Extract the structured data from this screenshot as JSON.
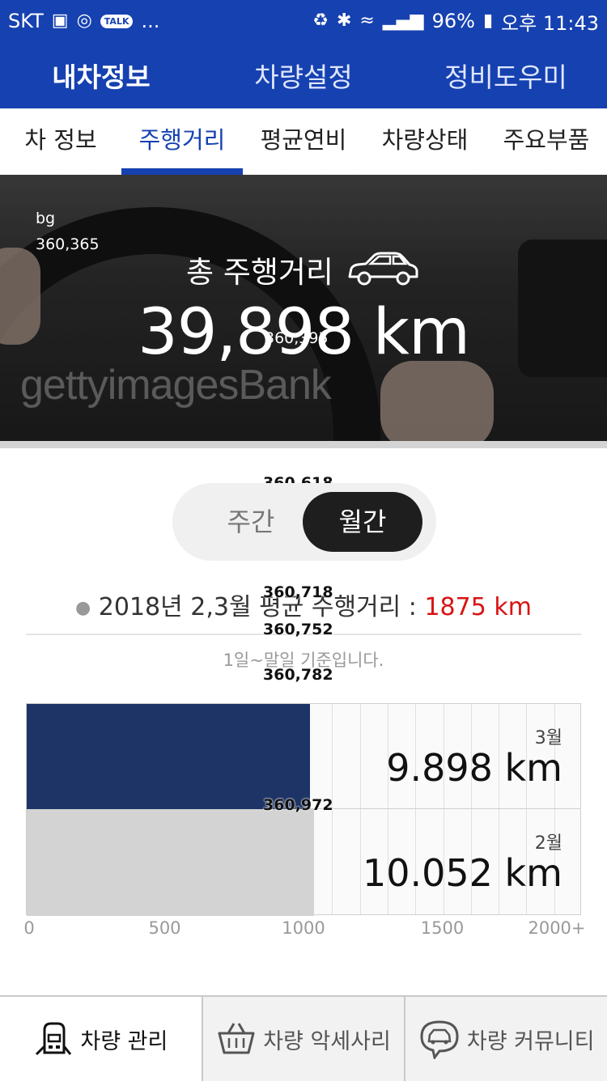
{
  "status_bar": {
    "carrier": "SKT",
    "icons": [
      "image-icon",
      "alarm-icon",
      "talk-icon",
      "more-icon",
      "battery-saver-icon",
      "bluetooth-icon",
      "wifi-icon",
      "signal-icon",
      "charging-icon"
    ],
    "talk_badge": "TALK",
    "more": "...",
    "battery": "96%",
    "time": "오후 11:43"
  },
  "top_nav": {
    "items": [
      "내차정보",
      "차량설정",
      "정비도우미"
    ],
    "active": "내차정보"
  },
  "sub_tabs": {
    "items": [
      "차 정보",
      "주행거리",
      "평균연비",
      "차량상태",
      "주요부품"
    ],
    "active": "주행거리"
  },
  "hero": {
    "bg_label": "bg",
    "bg_coords": "360,365",
    "total_label": "총 주행거리",
    "total_value": "39,898 km",
    "value_marker": "360,395",
    "watermark": "gettyimagesBank",
    "car_icon": "car-outline-icon"
  },
  "markers": {
    "toggle": "360,618",
    "avg": "360,718",
    "divider": "360,752",
    "note": "360,782",
    "chart": "360,972"
  },
  "toggle": {
    "options": [
      "주간",
      "월간"
    ],
    "selected": "월간"
  },
  "average": {
    "label": "2018년 2,3월 평균 주행거리 : ",
    "value": "1875 km",
    "note": "1일~말일 기준입니다."
  },
  "chart_data": {
    "type": "bar",
    "orientation": "horizontal",
    "categories": [
      "3월",
      "2월"
    ],
    "values": [
      9898,
      10052
    ],
    "value_labels": [
      "9.898 km",
      "10.052 km"
    ],
    "colors": [
      "#1e3366",
      "#d3d3d3"
    ],
    "xlim": [
      0,
      2000
    ],
    "x_ticks": [
      "0",
      "500",
      "1000",
      "1500",
      "2000+"
    ],
    "grid": true
  },
  "bottom_nav": {
    "items": [
      {
        "label": "차량 관리",
        "icon": "car-manage-icon"
      },
      {
        "label": "차량 악세사리",
        "icon": "basket-icon"
      },
      {
        "label": "차량 커뮤니티",
        "icon": "chat-car-icon"
      }
    ],
    "active": "차량 관리"
  },
  "colors": {
    "brand_blue": "#1641b0",
    "accent_red": "#d81414",
    "bar_dark": "#1e3366",
    "bar_light": "#d3d3d3"
  }
}
